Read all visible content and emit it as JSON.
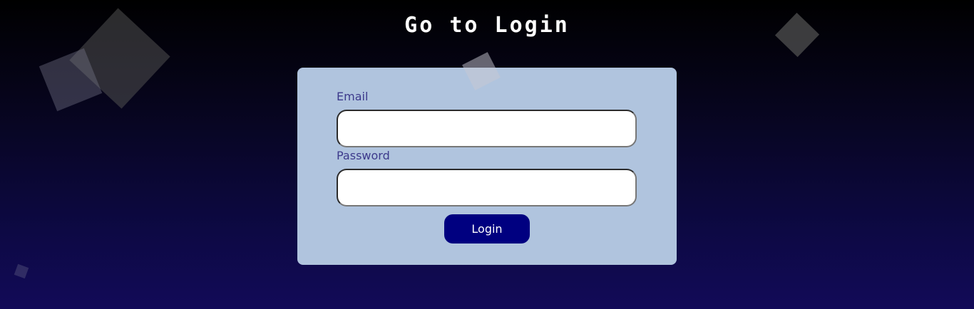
{
  "page": {
    "title": "Go to Login"
  },
  "form": {
    "email_label": "Email",
    "email_value": "",
    "password_label": "Password",
    "password_value": "",
    "login_label": "Login"
  },
  "colors": {
    "card_background": "#b0c4de",
    "button_background": "#000080",
    "label_color": "#3d3a8c",
    "title_color": "#ffffff"
  }
}
